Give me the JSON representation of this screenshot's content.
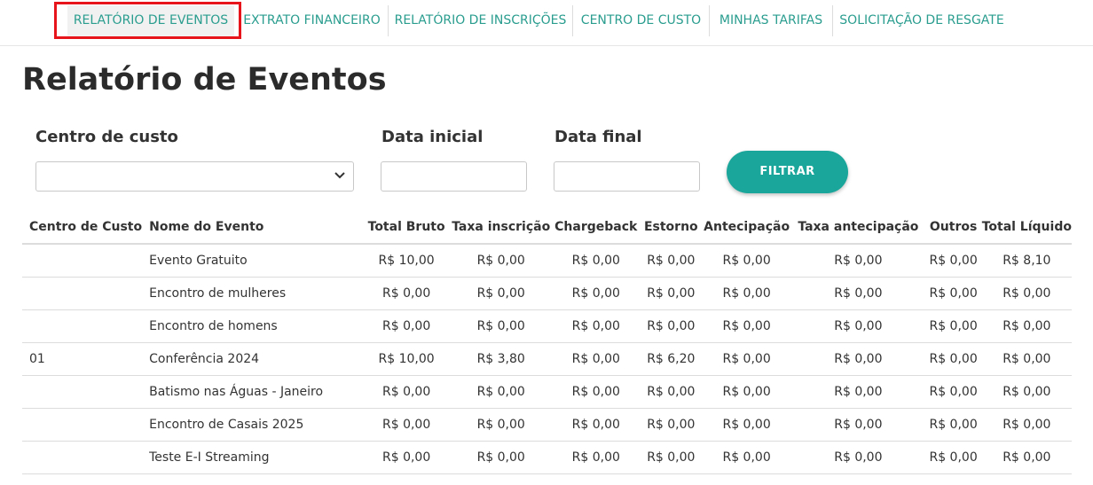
{
  "nav": {
    "tabs": [
      {
        "label": "RELATÓRIO DE EVENTOS",
        "active": true
      },
      {
        "label": "EXTRATO FINANCEIRO"
      },
      {
        "label": "RELATÓRIO DE INSCRIÇÕES"
      },
      {
        "label": "CENTRO DE CUSTO"
      },
      {
        "label": "MINHAS TARIFAS"
      },
      {
        "label": "SOLICITAÇÃO DE RESGATE"
      }
    ]
  },
  "page": {
    "title": "Relatório de Eventos"
  },
  "filters": {
    "cost_center_label": "Centro de custo",
    "cost_center_value": "",
    "start_date_label": "Data inicial",
    "start_date_value": "",
    "end_date_label": "Data final",
    "end_date_value": "",
    "filter_button": "FILTRAR"
  },
  "table": {
    "headers": [
      "Centro de Custo",
      "Nome do Evento",
      "Total Bruto",
      "Taxa inscrição",
      "Chargeback",
      "Estorno",
      "Antecipação",
      "Taxa antecipação",
      "Outros",
      "Total Líquido"
    ],
    "rows": [
      [
        "",
        "Evento Gratuito",
        "R$ 10,00",
        "R$ 0,00",
        "R$ 0,00",
        "R$ 0,00",
        "R$ 0,00",
        "R$ 0,00",
        "R$ 0,00",
        "R$ 8,10"
      ],
      [
        "",
        "Encontro de mulheres",
        "R$ 0,00",
        "R$ 0,00",
        "R$ 0,00",
        "R$ 0,00",
        "R$ 0,00",
        "R$ 0,00",
        "R$ 0,00",
        "R$ 0,00"
      ],
      [
        "",
        "Encontro de homens",
        "R$ 0,00",
        "R$ 0,00",
        "R$ 0,00",
        "R$ 0,00",
        "R$ 0,00",
        "R$ 0,00",
        "R$ 0,00",
        "R$ 0,00"
      ],
      [
        "01",
        "Conferência 2024",
        "R$ 10,00",
        "R$ 3,80",
        "R$ 0,00",
        "R$ 6,20",
        "R$ 0,00",
        "R$ 0,00",
        "R$ 0,00",
        "R$ 0,00"
      ],
      [
        "",
        "Batismo nas Águas - Janeiro",
        "R$ 0,00",
        "R$ 0,00",
        "R$ 0,00",
        "R$ 0,00",
        "R$ 0,00",
        "R$ 0,00",
        "R$ 0,00",
        "R$ 0,00"
      ],
      [
        "",
        "Encontro de Casais 2025",
        "R$ 0,00",
        "R$ 0,00",
        "R$ 0,00",
        "R$ 0,00",
        "R$ 0,00",
        "R$ 0,00",
        "R$ 0,00",
        "R$ 0,00"
      ],
      [
        "",
        "Teste E-I Streaming",
        "R$ 0,00",
        "R$ 0,00",
        "R$ 0,00",
        "R$ 0,00",
        "R$ 0,00",
        "R$ 0,00",
        "R$ 0,00",
        "R$ 0,00"
      ]
    ]
  },
  "colors": {
    "accent": "#1aa69a",
    "tab_text": "#2a9d8f",
    "highlight": "#e8141c"
  }
}
